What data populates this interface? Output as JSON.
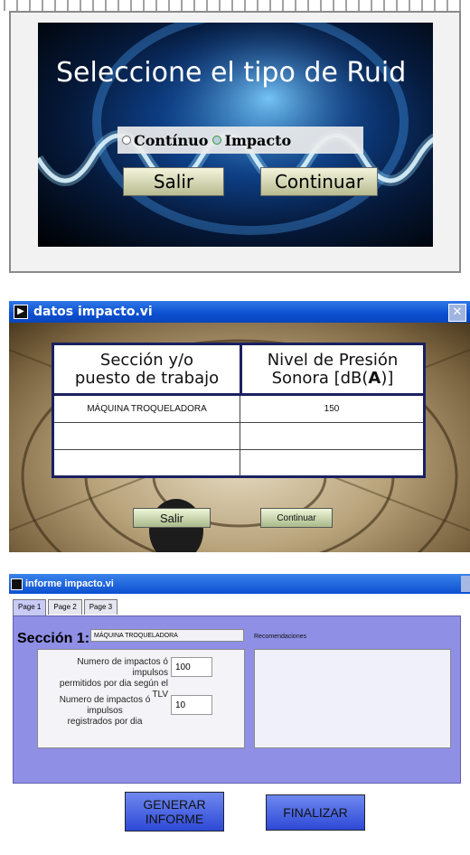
{
  "panel1": {
    "title": "Seleccione el tipo de Ruid",
    "radio_options": [
      {
        "label": "Contínuo",
        "selected": false
      },
      {
        "label": "Impacto",
        "selected": true
      }
    ],
    "buttons": {
      "salir": "Salir",
      "continuar": "Continuar"
    }
  },
  "panel2": {
    "window_title": "datos impacto.vi",
    "close_glyph": "✕",
    "table": {
      "headers": [
        "Sección y/o\npuesto de trabajo",
        "Nivel de Presión\nSonora [dB(A)]"
      ],
      "header2_prefix": "Nivel de Presión",
      "header2_suffix_a": "Sonora [dB(",
      "header2_bold": "A",
      "header2_suffix_b": ")]",
      "header1_line1": "Sección y/o",
      "header1_line2": "puesto de trabajo",
      "rows": [
        {
          "seccion": "MÁQUINA TROQUELADORA",
          "nivel": "150"
        },
        {
          "seccion": "",
          "nivel": ""
        },
        {
          "seccion": "",
          "nivel": ""
        }
      ]
    },
    "buttons": {
      "salir": "Salir",
      "continuar": "Continuar"
    }
  },
  "panel3": {
    "window_title": "informe impacto.vi",
    "tabs": [
      "Page 1",
      "Page 2",
      "Page 3"
    ],
    "section_label": "Sección 1:",
    "section_value": "MÁQUINA TROQUELADORA",
    "recommendations_label": "Recomendaciones",
    "field1_label_line1": "Numero de impactos ó impulsos",
    "field1_label_line2": "permitidos por dia según el  TLV",
    "field1_value": "100",
    "field2_label_line1": "Numero de impactos ó impulsos",
    "field2_label_line2": "registrados por dia",
    "field2_value": "10",
    "buttons": {
      "generar_line1": "GENERAR",
      "generar_line2": "INFORME",
      "finalizar": "FINALIZAR"
    }
  },
  "colors": {
    "titlebar_blue": "#0b4fd0",
    "panel_lavender": "#8f8fe6",
    "table_border": "#1a2060"
  }
}
